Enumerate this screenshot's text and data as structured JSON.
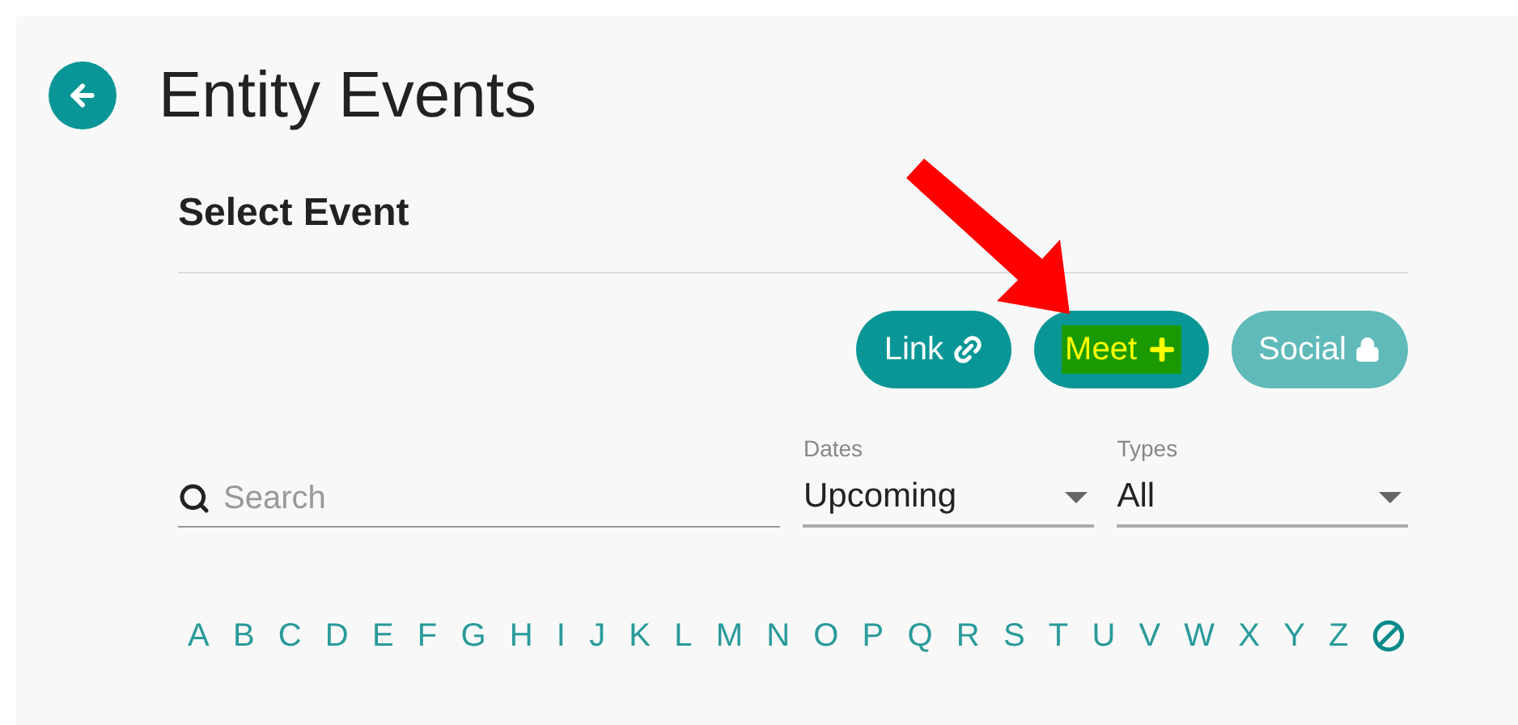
{
  "title": "Entity Events",
  "section_title": "Select Event",
  "actions": [
    {
      "label": "Link",
      "kind": "link",
      "disabled": false,
      "highlighted": false
    },
    {
      "label": "Meet",
      "kind": "add",
      "disabled": false,
      "highlighted": true
    },
    {
      "label": "Social",
      "kind": "lock",
      "disabled": true,
      "highlighted": false
    }
  ],
  "search": {
    "placeholder": "Search"
  },
  "filters": [
    {
      "label": "Dates",
      "value": "Upcoming"
    },
    {
      "label": "Types",
      "value": "All"
    }
  ],
  "letters": [
    "A",
    "B",
    "C",
    "D",
    "E",
    "F",
    "G",
    "H",
    "I",
    "J",
    "K",
    "L",
    "M",
    "N",
    "O",
    "P",
    "Q",
    "R",
    "S",
    "T",
    "U",
    "V",
    "W",
    "X",
    "Y",
    "Z"
  ],
  "annotations": [
    {
      "kind": "arrow",
      "color": "#ff0000"
    }
  ]
}
